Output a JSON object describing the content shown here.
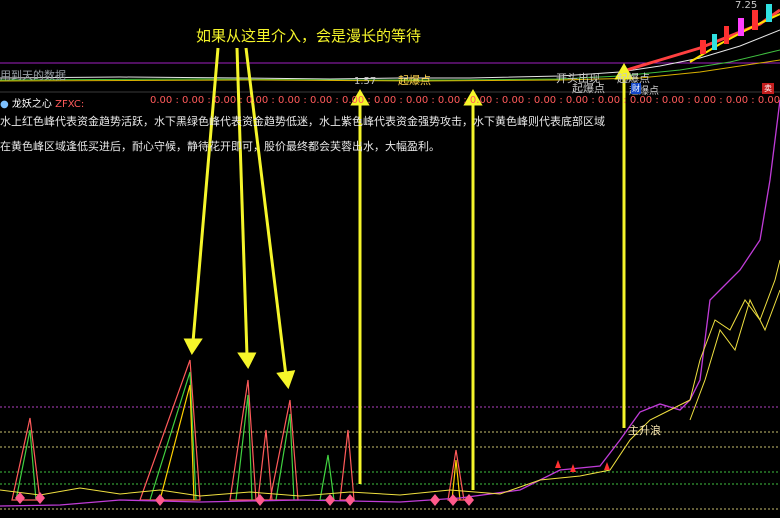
{
  "annotation": "如果从这里介入，会是漫长的等待",
  "top_caption": "用到天的数据",
  "top_labels": {
    "a": "1.57",
    "b": "起爆点",
    "c": "开头出现",
    "d": "起爆点",
    "e": "起爆点",
    "f": "起爆点"
  },
  "top_right_value": "7.25",
  "indicator": {
    "name": "龙妖之心",
    "code": "ZFXC:",
    "values_text": "0.00 : 0.00 : 0.00 : 0.00 : 0.00 : 0.00 : 0.00 : 0.00 : 0.00 : 0.00 : 0.00 : 0.00 : 0.00 : 0.00 : 0.00 : 0.00 : 0.00 : 0.00 : 0.00 : 0.00 : 0.00"
  },
  "tags": {
    "red": "卖",
    "blue": "财"
  },
  "description": {
    "line1": "水上红色峰代表资金趋势活跃，水下黑绿色峰代表资金趋势低迷，水上紫色峰代表资金强势攻击，水下黄色峰则代表底部区域",
    "line2": "在黄色峰区域逢低买进后，耐心守候，静待花开即可，股价最终都会芙蓉出水，大幅盈利。"
  },
  "wave_label": "主升浪",
  "colors": {
    "annotation": "#f5f52a",
    "purple_line": "#c03cd8",
    "yellow_line": "#f0e040",
    "bg": "#000000"
  }
}
